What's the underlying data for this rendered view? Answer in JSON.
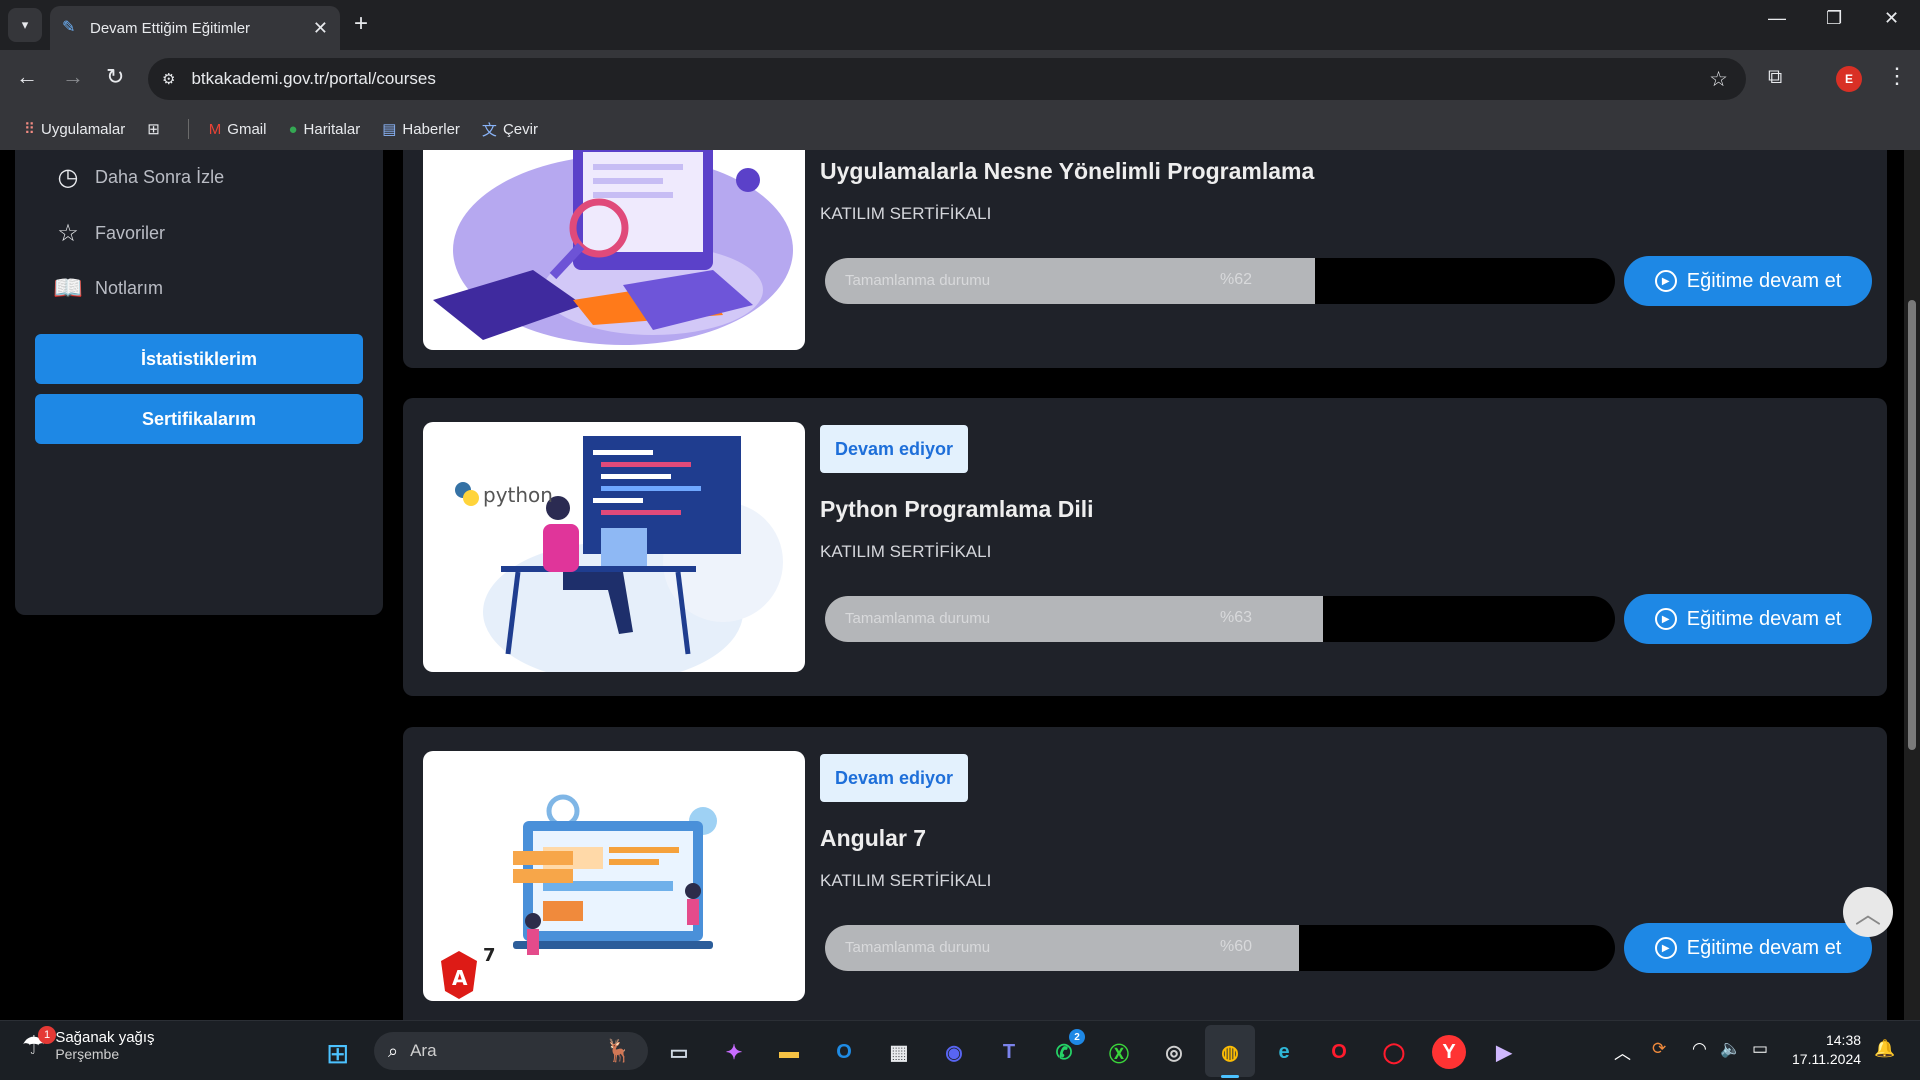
{
  "browser": {
    "tab_title": "Devam Ettiğim Eğitimler",
    "url": "btkakademi.gov.tr/portal/courses",
    "profile_initial": "E",
    "bookmarks": [
      "Uygulamalar",
      "Gmail",
      "Haritalar",
      "Haberler",
      "Çevir"
    ]
  },
  "sidebar": {
    "items": [
      {
        "label": "Daha Sonra İzle",
        "icon": "clock-icon"
      },
      {
        "label": "Favoriler",
        "icon": "star-icon"
      },
      {
        "label": "Notlarım",
        "icon": "book-icon"
      }
    ],
    "buttons": [
      "İstatistiklerim",
      "Sertifikalarım"
    ]
  },
  "courses": [
    {
      "badge": "",
      "title": "Uygulamalarla Nesne Yönelimli Programlama",
      "certificate": "KATILIM SERTİFİKALI",
      "progress_label": "Tamamlanma durumu",
      "progress_text": "%62",
      "progress_value": 0.62,
      "button": "Eğitime devam et"
    },
    {
      "badge": "Devam ediyor",
      "title": "Python Programlama Dili",
      "certificate": "KATILIM SERTİFİKALI",
      "progress_label": "Tamamlanma durumu",
      "progress_text": "%63",
      "progress_value": 0.63,
      "button": "Eğitime devam et"
    },
    {
      "badge": "Devam ediyor",
      "title": "Angular 7",
      "certificate": "KATILIM SERTİFİKALI",
      "progress_label": "Tamamlanma durumu",
      "progress_text": "%60",
      "progress_value": 0.6,
      "button": "Eğitime devam et"
    }
  ],
  "thumbnails": {
    "python_word": "python",
    "angular_letter": "A",
    "angular_version": "7"
  },
  "taskbar": {
    "weather_title": "Sağanak yağış",
    "weather_day": "Perşembe",
    "weather_badge": "1",
    "search_placeholder": "Ara",
    "whatsapp_badge": "2",
    "time": "14:38",
    "date": "17.11.2024"
  },
  "colors": {
    "accent": "#1e88e5",
    "card_bg": "#1f2229",
    "badge_bg": "#e3f1fd",
    "progress_fill": "#b4b6b9"
  }
}
